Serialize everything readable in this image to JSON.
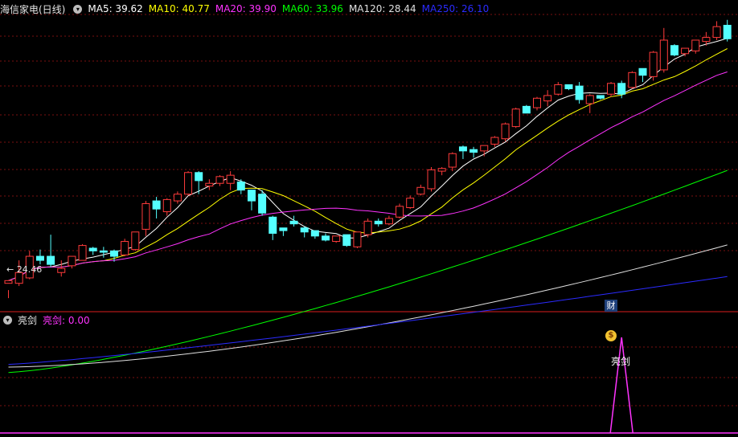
{
  "main_header": {
    "title": "海信家电(日线)",
    "ma": [
      {
        "label": "MA5: 39.62",
        "color": "#ffffff"
      },
      {
        "label": "MA10: 40.77",
        "color": "#ffff00"
      },
      {
        "label": "MA20: 39.90",
        "color": "#ff33ff"
      },
      {
        "label": "MA60: 33.96",
        "color": "#00ff00"
      },
      {
        "label": "MA120: 28.44",
        "color": "#e0e0e0"
      },
      {
        "label": "MA250: 26.10",
        "color": "#2b2bff"
      }
    ]
  },
  "price_low_label": "24.46",
  "event_marker": "财",
  "sub_header": {
    "title": "亮剑",
    "value_label": "亮剑: 0.00"
  },
  "signal_label": "亮剑",
  "colors": {
    "bg": "#000000",
    "grid": "#7a1010",
    "up": "#ff3b3b",
    "down": "#54ffff",
    "ma5": "#ffffff",
    "ma10": "#ffff00",
    "ma20": "#ff33ff",
    "ma60": "#00ff00",
    "ma120": "#e0e0e0",
    "ma250": "#2b2bff",
    "signal": "#ff33ff"
  },
  "chart_data": {
    "type": "candlestick",
    "price_range": [
      23.5,
      45.5
    ],
    "candles": [
      [
        25.6,
        25.8,
        25.1,
        24.5
      ],
      [
        25.6,
        26.4,
        27.3,
        25.4
      ],
      [
        26.0,
        27.6,
        28.0,
        25.9
      ],
      [
        27.6,
        27.3,
        28.1,
        27.0
      ],
      [
        27.6,
        27.0,
        29.2,
        26.8
      ],
      [
        26.4,
        26.7,
        27.3,
        26.1
      ],
      [
        26.9,
        27.6,
        27.6,
        26.7
      ],
      [
        27.3,
        28.4,
        28.5,
        27.3
      ],
      [
        28.2,
        28.0,
        28.3,
        27.7
      ],
      [
        28.0,
        27.9,
        28.3,
        27.5
      ],
      [
        28.0,
        27.6,
        28.1,
        27.2
      ],
      [
        27.7,
        28.7,
        28.9,
        27.6
      ],
      [
        28.1,
        29.4,
        29.4,
        28.0
      ],
      [
        29.6,
        31.5,
        31.7,
        29.1
      ],
      [
        31.7,
        31.1,
        32.0,
        30.4
      ],
      [
        30.9,
        31.8,
        31.9,
        30.6
      ],
      [
        31.7,
        32.2,
        32.4,
        31.5
      ],
      [
        32.2,
        33.8,
        33.9,
        32.1
      ],
      [
        33.8,
        33.2,
        33.9,
        32.2
      ],
      [
        32.8,
        33.0,
        33.3,
        32.5
      ],
      [
        33.0,
        33.5,
        33.6,
        32.8
      ],
      [
        33.0,
        33.6,
        33.9,
        32.5
      ],
      [
        33.1,
        32.5,
        33.3,
        32.2
      ],
      [
        32.5,
        31.7,
        32.3,
        31.0
      ],
      [
        32.2,
        30.8,
        32.5,
        30.6
      ],
      [
        30.5,
        29.3,
        30.6,
        28.8
      ],
      [
        29.7,
        29.5,
        29.7,
        29.1
      ],
      [
        30.2,
        30.0,
        30.6,
        29.8
      ],
      [
        29.7,
        29.4,
        29.8,
        29.0
      ],
      [
        29.5,
        29.1,
        29.5,
        28.9
      ],
      [
        29.1,
        28.8,
        29.3,
        28.7
      ],
      [
        28.7,
        29.1,
        29.1,
        28.6
      ],
      [
        29.2,
        28.4,
        29.2,
        28.3
      ],
      [
        28.3,
        29.4,
        29.3,
        28.2
      ],
      [
        29.2,
        30.2,
        30.4,
        29.0
      ],
      [
        30.2,
        30.0,
        30.4,
        29.8
      ],
      [
        30.0,
        30.4,
        30.6,
        29.9
      ],
      [
        30.5,
        31.3,
        31.5,
        30.4
      ],
      [
        31.2,
        31.9,
        32.1,
        31.1
      ],
      [
        32.2,
        32.7,
        32.9,
        32.1
      ],
      [
        32.6,
        34.0,
        34.2,
        32.4
      ],
      [
        33.9,
        34.1,
        34.2,
        33.6
      ],
      [
        34.2,
        35.2,
        35.3,
        33.9
      ],
      [
        35.7,
        35.4,
        35.8,
        34.8
      ],
      [
        35.5,
        35.3,
        35.7,
        34.9
      ],
      [
        35.4,
        35.8,
        35.8,
        35.0
      ],
      [
        35.9,
        36.4,
        36.5,
        35.7
      ],
      [
        36.3,
        37.4,
        37.5,
        36.1
      ],
      [
        37.2,
        38.5,
        38.6,
        37.1
      ],
      [
        38.7,
        38.2,
        38.8,
        38.3
      ],
      [
        38.6,
        39.3,
        39.4,
        38.4
      ],
      [
        39.1,
        39.5,
        39.9,
        38.7
      ],
      [
        39.6,
        40.3,
        40.5,
        39.5
      ],
      [
        40.3,
        40.0,
        40.2,
        39.9
      ],
      [
        40.2,
        39.2,
        40.5,
        38.9
      ],
      [
        38.9,
        39.5,
        39.6,
        38.2
      ],
      [
        39.5,
        39.3,
        39.5,
        39.2
      ],
      [
        39.6,
        40.4,
        40.5,
        39.4
      ],
      [
        40.4,
        39.6,
        40.6,
        39.3
      ],
      [
        40.1,
        41.2,
        41.3,
        40.0
      ],
      [
        41.5,
        41.0,
        41.5,
        40.5
      ],
      [
        40.9,
        42.7,
        42.8,
        40.6
      ],
      [
        41.4,
        43.6,
        44.5,
        41.2
      ],
      [
        43.2,
        42.5,
        43.3,
        42.4
      ],
      [
        42.6,
        43.0,
        43.0,
        42.4
      ],
      [
        42.8,
        43.6,
        43.6,
        42.6
      ],
      [
        43.5,
        43.8,
        44.2,
        43.2
      ],
      [
        43.8,
        44.6,
        45.0,
        43.6
      ],
      [
        44.7,
        43.7,
        45.1,
        43.5
      ]
    ],
    "signal_values_last_index": [
      0,
      0,
      0,
      0,
      0,
      0,
      0,
      0,
      0,
      0,
      0,
      0,
      0,
      0,
      0,
      0,
      0,
      0,
      0,
      0,
      0,
      0,
      0,
      0,
      0,
      0,
      0,
      0,
      0,
      0,
      0,
      0,
      0,
      0,
      0,
      0,
      0,
      0,
      0,
      0,
      0,
      0,
      0,
      0,
      0,
      0,
      0,
      0,
      0,
      0,
      0,
      0,
      0,
      0,
      0,
      0,
      0,
      0,
      1,
      0,
      0,
      0,
      0,
      0,
      0,
      0,
      0,
      0,
      0
    ],
    "ma_series": [
      {
        "name": "MA5",
        "end_value": 39.62
      },
      {
        "name": "MA10",
        "end_value": 40.77
      },
      {
        "name": "MA20",
        "end_value": 39.9
      },
      {
        "name": "MA60",
        "end_value": 33.96
      },
      {
        "name": "MA120",
        "end_value": 28.44
      },
      {
        "name": "MA250",
        "end_value": 26.1
      }
    ]
  }
}
